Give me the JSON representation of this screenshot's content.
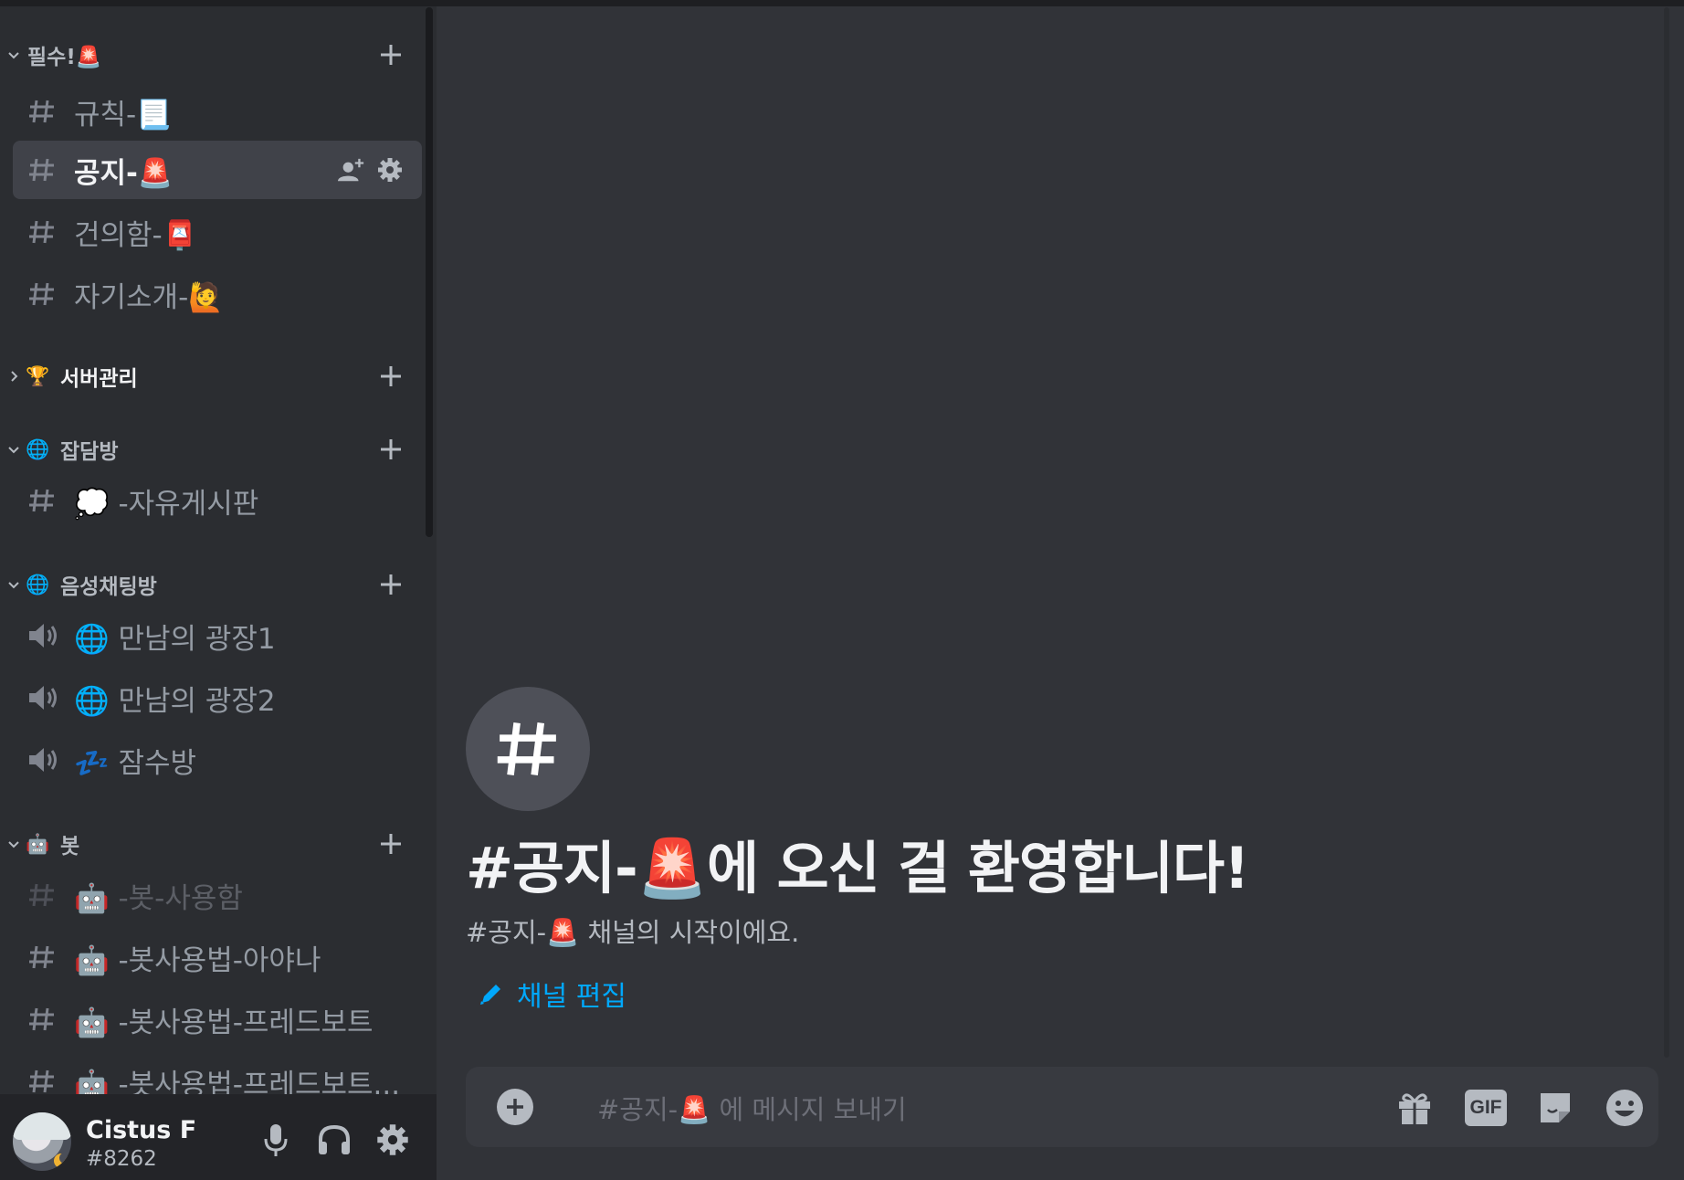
{
  "sidebar": {
    "categories": [
      {
        "name": "필수!🚨",
        "emoji": "",
        "collapsed": false
      },
      {
        "name": "서버관리",
        "emoji": "🏆",
        "collapsed": true
      },
      {
        "name": "잡담방",
        "emoji": "🌐",
        "collapsed": false
      },
      {
        "name": "음성채팅방",
        "emoji": "🌐",
        "collapsed": false
      },
      {
        "name": "봇",
        "emoji": "🤖",
        "collapsed": false
      }
    ],
    "channels": [
      {
        "label": "규칙-📃",
        "type": "text"
      },
      {
        "label": "공지-🚨",
        "type": "text",
        "selected": true
      },
      {
        "label": "건의함-📮",
        "type": "text"
      },
      {
        "label": "자기소개-🙋",
        "type": "text"
      },
      {
        "label": "💭 -자유게시판",
        "type": "text"
      },
      {
        "label": "🌐 만남의 광장1",
        "type": "voice"
      },
      {
        "label": "🌐 만남의 광장2",
        "type": "voice"
      },
      {
        "label": "💤 잠수방",
        "type": "voice"
      },
      {
        "label": "🤖 -봇-사용함",
        "type": "text",
        "muted": true
      },
      {
        "label": "🤖 -봇사용법-아야나",
        "type": "text"
      },
      {
        "label": "🤖 -봇사용법-프레드보트",
        "type": "text"
      },
      {
        "label": "🤖 -봇사용법-프레드보트...",
        "type": "text"
      }
    ]
  },
  "user": {
    "name": "Cistus F",
    "tag": "#8262"
  },
  "main": {
    "hero_title": "#공지-🚨에 오신 걸 환영합니다!",
    "hero_subtitle": "#공지-🚨  채널의 시작이에요.",
    "edit_label": "채널 편집",
    "composer_placeholder": "#공지-🚨 에 메시지 보내기",
    "gif_label": "GIF"
  },
  "colors": {
    "sidebar_bg": "#2b2d31",
    "main_bg": "#313338",
    "selected_bg": "#404249",
    "link_accent": "#00a8fc",
    "composer_bg": "#383a40"
  },
  "icons": [
    "chevron-down-icon",
    "chevron-right-icon",
    "plus-icon",
    "hash-icon",
    "speaker-icon",
    "invite-icon",
    "gear-icon",
    "microphone-icon",
    "headphones-icon",
    "pencil-icon",
    "plus-circle-icon",
    "gift-icon",
    "gif-icon",
    "sticker-icon",
    "emoji-icon"
  ]
}
